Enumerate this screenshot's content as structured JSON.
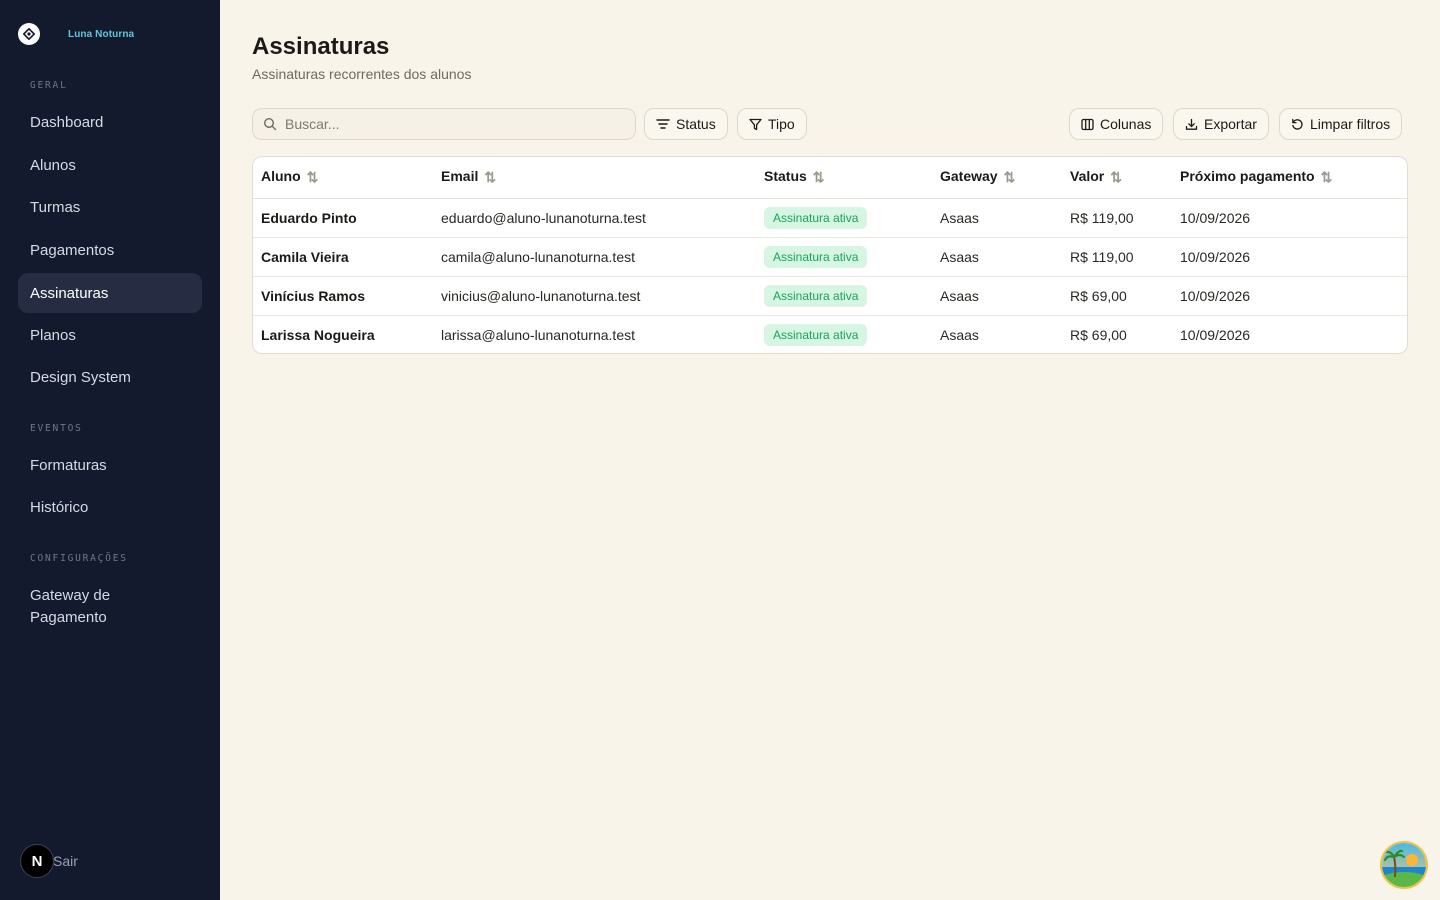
{
  "app": {
    "brand_name": "Luna Noturna"
  },
  "sidebar": {
    "sections": [
      {
        "label": "GERAL"
      },
      {
        "label": "EVENTOS"
      },
      {
        "label": "CONFIGURAÇÕES"
      }
    ],
    "items": [
      {
        "label": "Dashboard"
      },
      {
        "label": "Alunos"
      },
      {
        "label": "Turmas"
      },
      {
        "label": "Pagamentos"
      },
      {
        "label": "Assinaturas",
        "active": true
      },
      {
        "label": "Planos"
      },
      {
        "label": "Design System"
      },
      {
        "label": "Formaturas"
      },
      {
        "label": "Histórico"
      },
      {
        "label": "Gateway de Pagamento"
      }
    ],
    "logout_label": "Sair",
    "badge_letter": "N"
  },
  "header": {
    "title": "Assinaturas",
    "subtitle": "Assinaturas recorrentes dos alunos"
  },
  "toolbar": {
    "search_placeholder": "Buscar...",
    "status_label": "Status",
    "tipo_label": "Tipo",
    "columns_label": "Colunas",
    "export_label": "Exportar",
    "clear_label": "Limpar filtros"
  },
  "table": {
    "columns": [
      "Aluno",
      "Email",
      "Status",
      "Gateway",
      "Valor",
      "Próximo pagamento"
    ],
    "rows": [
      {
        "aluno": "Eduardo Pinto",
        "email": "eduardo@aluno-lunanoturna.test",
        "status": "Assinatura ativa",
        "gateway": "Asaas",
        "valor": "R$ 119,00",
        "proximo": "10/09/2026"
      },
      {
        "aluno": "Camila Vieira",
        "email": "camila@aluno-lunanoturna.test",
        "status": "Assinatura ativa",
        "gateway": "Asaas",
        "valor": "R$ 119,00",
        "proximo": "10/09/2026"
      },
      {
        "aluno": "Vinícius Ramos",
        "email": "vinicius@aluno-lunanoturna.test",
        "status": "Assinatura ativa",
        "gateway": "Asaas",
        "valor": "R$ 69,00",
        "proximo": "10/09/2026"
      },
      {
        "aluno": "Larissa Nogueira",
        "email": "larissa@aluno-lunanoturna.test",
        "status": "Assinatura ativa",
        "gateway": "Asaas",
        "valor": "R$ 69,00",
        "proximo": "10/09/2026"
      }
    ]
  },
  "colors": {
    "sidebar_bg": "#141a2e",
    "page_bg": "#f8f4ea",
    "brand_accent": "#5ec7d8",
    "status_active_bg": "#d6f5e3",
    "status_active_text": "#1aa55a"
  }
}
